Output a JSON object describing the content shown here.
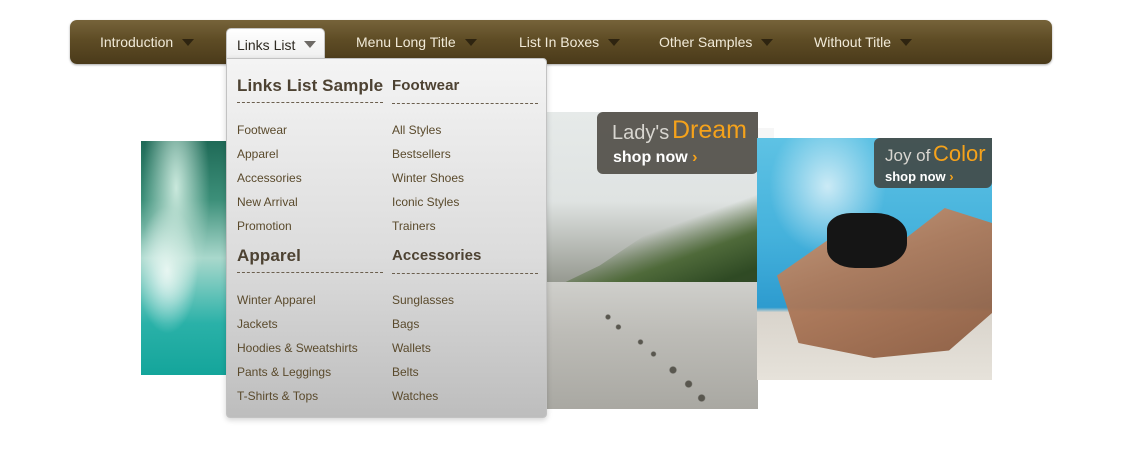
{
  "nav": {
    "items": [
      {
        "label": "Introduction"
      },
      {
        "label": "Links List"
      },
      {
        "label": "Menu Long Title"
      },
      {
        "label": "List In Boxes"
      },
      {
        "label": "Other Samples"
      },
      {
        "label": "Without Title"
      }
    ],
    "active_index": 1
  },
  "dropdown": {
    "columns": [
      {
        "sections": [
          {
            "title": "Links List Sample",
            "links": [
              "Footwear",
              "Apparel",
              "Accessories",
              "New Arrival",
              "Promotion"
            ]
          },
          {
            "title": "Apparel",
            "links": [
              "Winter Apparel",
              "Jackets",
              "Hoodies & Sweatshirts",
              "Pants & Leggings",
              "T-Shirts & Tops"
            ]
          }
        ]
      },
      {
        "sections": [
          {
            "title": "Footwear",
            "links": [
              "All Styles",
              "Bestsellers",
              "Winter Shoes",
              "Iconic Styles",
              "Trainers"
            ]
          },
          {
            "title": "Accessories",
            "links": [
              "Sunglasses",
              "Bags",
              "Wallets",
              "Belts",
              "Watches"
            ]
          }
        ]
      }
    ]
  },
  "banners": {
    "dream": {
      "line1": "Lady's",
      "line2": "Dream",
      "cta": "shop now",
      "chevron": "›"
    },
    "color": {
      "line1": "Joy of",
      "line2": "Color",
      "cta": "shop now",
      "chevron": "›"
    }
  },
  "colors": {
    "navbar": "#5e4c25",
    "nav_text": "#f1ead8",
    "link_text": "#5a4a2c",
    "banner_accent": "#f5a21b"
  }
}
